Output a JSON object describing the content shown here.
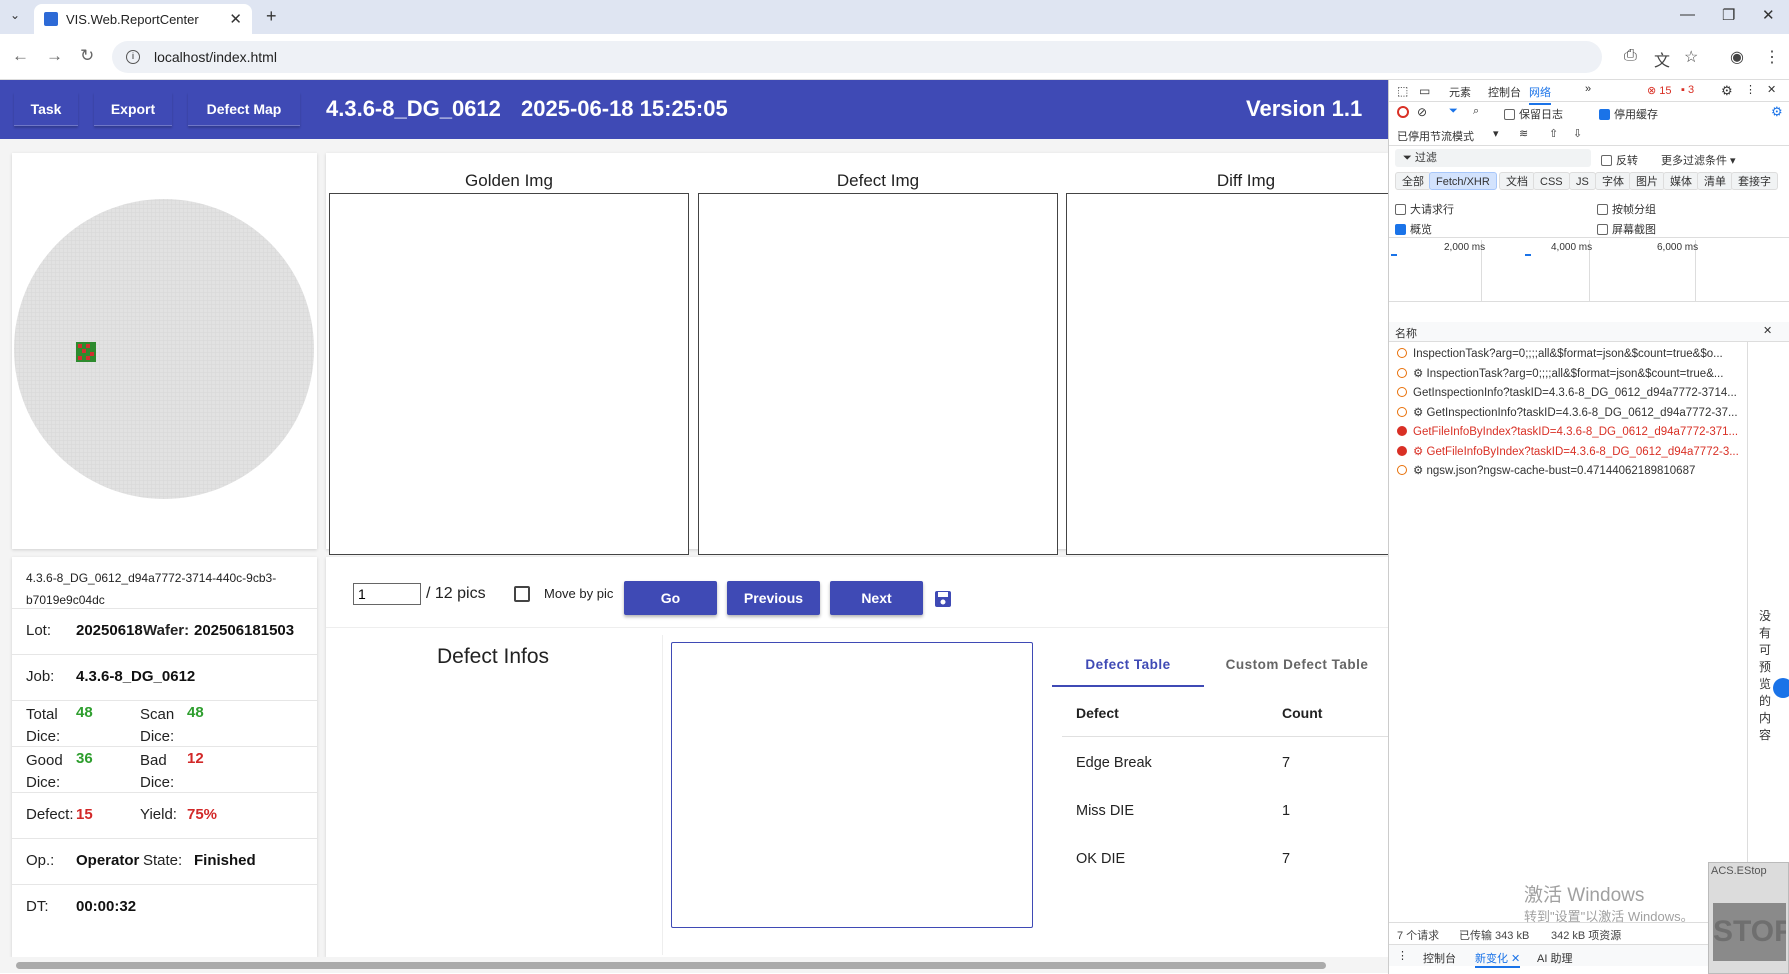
{
  "browser": {
    "tab_title": "VIS.Web.ReportCenter",
    "url": "localhost/index.html"
  },
  "header": {
    "nav": [
      "Task",
      "Export",
      "Defect Map"
    ],
    "task_title": "4.3.6-8_DG_0612",
    "timestamp": "2025-06-18 15:25:05",
    "version": "Version 1.1"
  },
  "images": {
    "golden": "Golden Img",
    "defect": "Defect Img",
    "diff": "Diff Img"
  },
  "wafer_info": {
    "task_id": "4.3.6-8_DG_0612_d94a7772-3714-440c-9cb3-b7019e9c04dc",
    "lot_label": "Lot:",
    "lot": "20250618",
    "wafer_label": "Wafer:",
    "wafer": "202506181503",
    "job_label": "Job:",
    "job": "4.3.6-8_DG_0612",
    "total_label": "Total Dice:",
    "total": "48",
    "scan_label": "Scan Dice:",
    "scan": "48",
    "good_label": "Good Dice:",
    "good": "36",
    "bad_label": "Bad Dice:",
    "bad": "12",
    "defect_label": "Defect:",
    "defect": "15",
    "yield_label": "Yield:",
    "yield": "75%",
    "op_label": "Op.:",
    "op": "Operator",
    "state_label": "State:",
    "state": "Finished",
    "dt_label": "DT:",
    "dt": "00:00:32"
  },
  "pager": {
    "value": "1",
    "total": "/ 12 pics",
    "move_by_pic": "Move by pic",
    "go": "Go",
    "previous": "Previous",
    "next": "Next"
  },
  "defect_infos": {
    "title": "Defect Infos",
    "tabs": [
      "Defect Table",
      "Custom Defect Table"
    ],
    "columns": [
      "Defect",
      "Count"
    ],
    "rows": [
      {
        "defect": "Edge Break",
        "count": "7"
      },
      {
        "defect": "Miss DIE",
        "count": "1"
      },
      {
        "defect": "OK DIE",
        "count": "7"
      }
    ]
  },
  "devtools": {
    "tabs": [
      "元素",
      "控制台",
      "网络"
    ],
    "error_count": "15",
    "warn_count": "3",
    "preserve_log": "保留日志",
    "disable_cache": "停用缓存",
    "throttle": "已停用节流模式",
    "filter": "过滤",
    "invert": "反转",
    "more_filters": "更多过滤条件",
    "filter_types": [
      "全部",
      "Fetch/XHR",
      "文档",
      "CSS",
      "JS",
      "字体",
      "图片",
      "媒体",
      "清单",
      "套接字"
    ],
    "big_rows": "大请求行",
    "group_by_frame": "按帧分组",
    "overview": "概览",
    "screenshots": "屏幕截图",
    "timeline": [
      "2,000 ms",
      "4,000 ms",
      "6,000 ms"
    ],
    "name_col": "名称",
    "requests": [
      {
        "name": "InspectionTask?arg=0;;;;all&$format=json&$count=true&$o...",
        "error": false
      },
      {
        "name": "⚙ InspectionTask?arg=0;;;;all&$format=json&$count=true&...",
        "error": false
      },
      {
        "name": "GetInspectionInfo?taskID=4.3.6-8_DG_0612_d94a7772-3714...",
        "error": false
      },
      {
        "name": "⚙ GetInspectionInfo?taskID=4.3.6-8_DG_0612_d94a7772-37...",
        "error": false
      },
      {
        "name": "GetFileInfoByIndex?taskID=4.3.6-8_DG_0612_d94a7772-371...",
        "error": true
      },
      {
        "name": "⚙ GetFileInfoByIndex?taskID=4.3.6-8_DG_0612_d94a7772-3...",
        "error": true
      },
      {
        "name": "⚙ ngsw.json?ngsw-cache-bust=0.47144062189810687",
        "error": false
      }
    ],
    "status": [
      "7 个请求",
      "已传输 343 kB",
      "342 kB 项资源"
    ],
    "drawer": [
      "控制台",
      "新变化",
      "AI 助理"
    ],
    "side_text": "没有可预览的内容"
  },
  "overlay": {
    "activate_title": "激活 Windows",
    "activate_sub": "转到\"设置\"以激活 Windows。",
    "acs": "ACS.EStop",
    "stop": "STOP"
  },
  "colors": {
    "primary": "#3f4ab5",
    "good": "#2e9e2e",
    "bad": "#d22828"
  }
}
